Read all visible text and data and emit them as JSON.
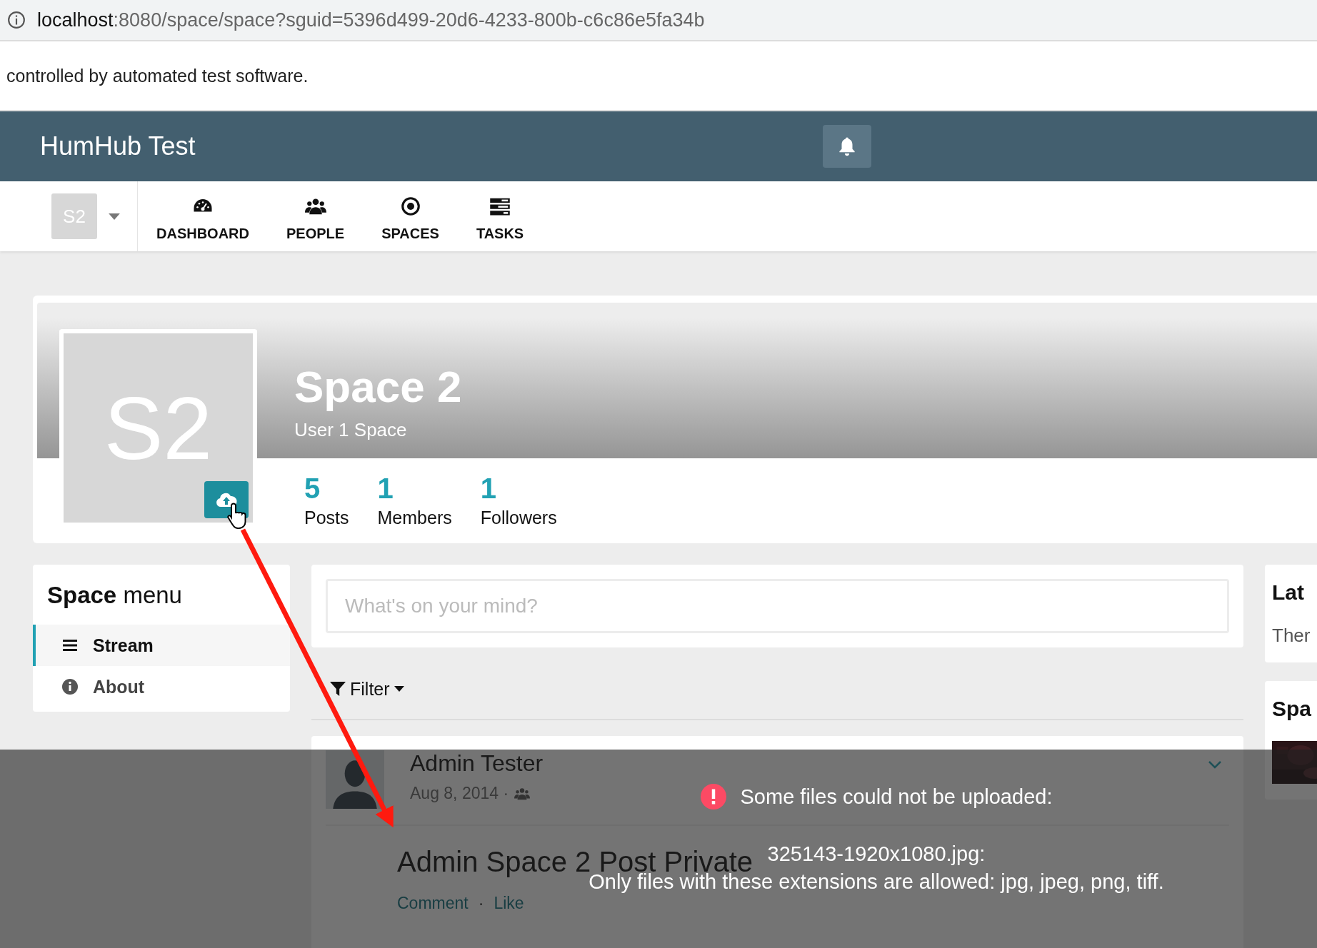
{
  "browser": {
    "url_host": "localhost",
    "url_rest": ":8080/space/space?sguid=5396d499-20d6-4233-800b-c6c86e5fa34b"
  },
  "automation_notice": "controlled by automated test software.",
  "navbar": {
    "title": "HumHub Test"
  },
  "top_menu": {
    "space_chooser": "S2",
    "items": [
      {
        "label": "DASHBOARD"
      },
      {
        "label": "PEOPLE"
      },
      {
        "label": "SPACES"
      },
      {
        "label": "TASKS"
      }
    ]
  },
  "space": {
    "avatar": "S2",
    "name": "Space 2",
    "description": "User 1 Space",
    "stats": [
      {
        "count": "5",
        "label": "Posts"
      },
      {
        "count": "1",
        "label": "Members"
      },
      {
        "count": "1",
        "label": "Followers"
      }
    ]
  },
  "space_menu": {
    "title": "**Space** menu",
    "items": [
      {
        "label": "Stream",
        "selected": true
      },
      {
        "label": "About",
        "selected": false
      }
    ]
  },
  "composer": {
    "placeholder": "What's on your mind?"
  },
  "filter": {
    "label": "Filter"
  },
  "post": {
    "author": "Admin Tester",
    "date": "Aug 8, 2014 ·",
    "title": "Admin Space 2 Post Private",
    "actions": [
      "Comment",
      "Like"
    ],
    "separator": "·"
  },
  "right_panels": [
    {
      "title": "Lat",
      "text": "Ther"
    },
    {
      "title": "Spa",
      "kind": "picture"
    }
  ],
  "error_overlay": {
    "heading": "Some files could not be uploaded:",
    "file": "325143-1920x1080.jpg:",
    "message": "Only files with these extensions are allowed: jpg, jpeg, png, tiff."
  }
}
